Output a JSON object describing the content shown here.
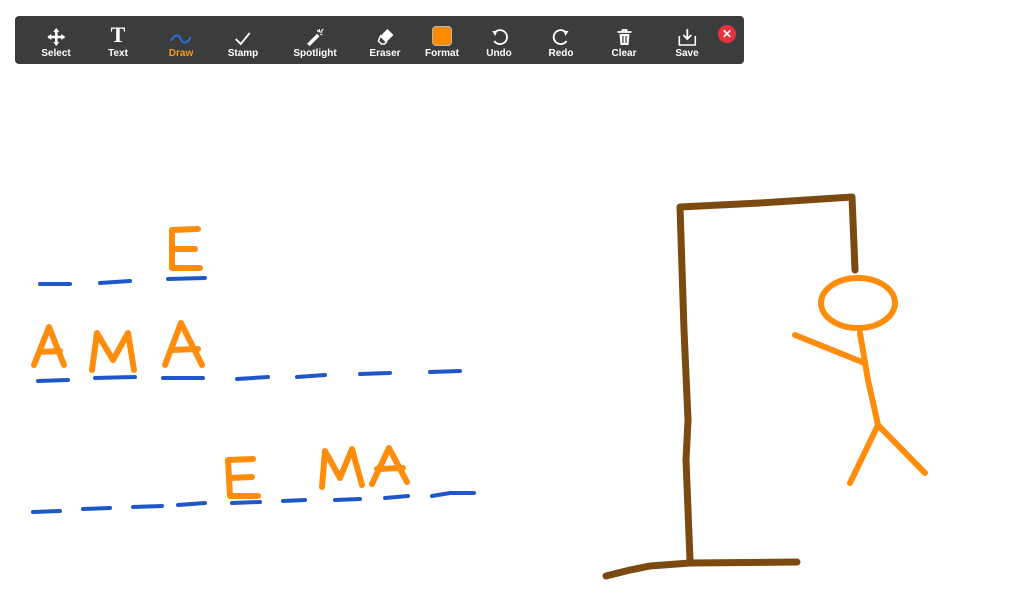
{
  "toolbar": {
    "tools": [
      {
        "label": "Select",
        "icon": "move-icon"
      },
      {
        "label": "Text",
        "icon": "text-icon"
      },
      {
        "label": "Draw",
        "icon": "draw-wave-icon",
        "active": true
      },
      {
        "label": "Stamp",
        "icon": "checkmark-icon"
      },
      {
        "label": "Spotlight",
        "icon": "magic-wand-icon"
      },
      {
        "label": "Eraser",
        "icon": "eraser-icon"
      },
      {
        "label": "Format",
        "icon": "color-swatch-icon"
      },
      {
        "label": "Undo",
        "icon": "undo-icon"
      },
      {
        "label": "Redo",
        "icon": "redo-icon"
      },
      {
        "label": "Clear",
        "icon": "trash-icon"
      },
      {
        "label": "Save",
        "icon": "save-download-icon"
      }
    ],
    "close_icon": "close-icon"
  },
  "colors": {
    "toolbar_bg": "#3b3c3d",
    "active": "#f49b20",
    "format_swatch": "#ff8c00",
    "blank_stroke": "#1f57c9",
    "letter_stroke": "#ff8c0a",
    "gallows_stroke": "#7a4a10",
    "close": "#e8323c"
  },
  "drawing": {
    "guessed_letters_shown": [
      "E",
      "A",
      "M",
      "A",
      "E",
      "M",
      "A"
    ]
  }
}
